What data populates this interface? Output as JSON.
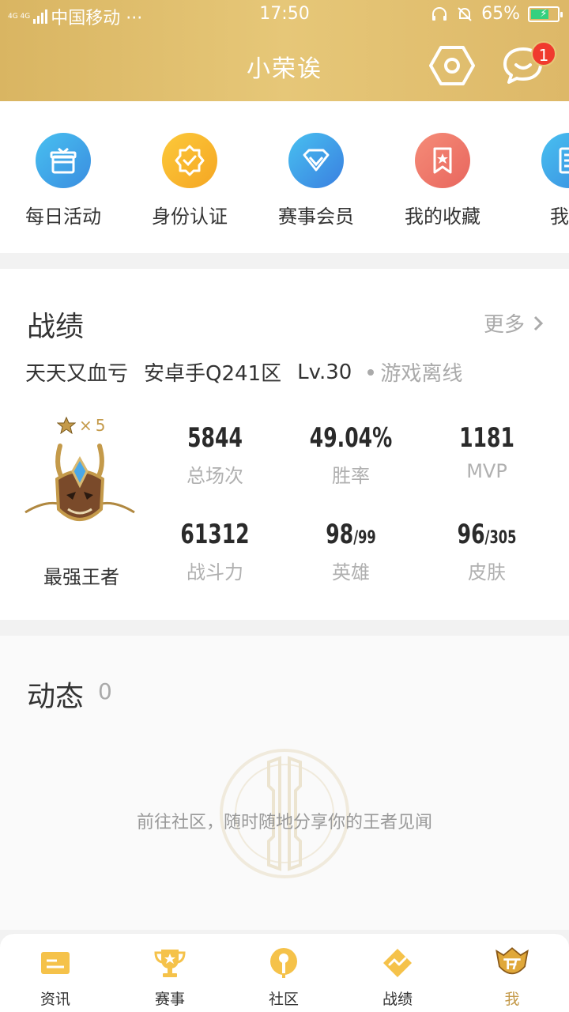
{
  "status_bar": {
    "network": "4G 4G",
    "carrier": "中国移动 ···",
    "time": "17:50",
    "battery": "65%"
  },
  "header": {
    "title": "小荣诶",
    "message_badge": "1"
  },
  "quick_actions": [
    {
      "label": "每日活动",
      "icon": "gift-icon",
      "color": "#3ba6e8"
    },
    {
      "label": "身份认证",
      "icon": "verified-badge-icon",
      "color": "#f7b32b"
    },
    {
      "label": "赛事会员",
      "icon": "diamond-icon",
      "color": "#3ba6e8"
    },
    {
      "label": "我的收藏",
      "icon": "bookmark-icon",
      "color": "#ef7b6b"
    },
    {
      "label": "我的",
      "icon": "document-icon",
      "color": "#3ba6e8"
    }
  ],
  "stats": {
    "title": "战绩",
    "more": "更多",
    "player_name": "天天又血亏",
    "server": "安卓手Q241区",
    "level": "Lv.30",
    "online_status": "游戏离线",
    "stars_prefix": "×",
    "stars": "5",
    "rank": "最强王者",
    "items": [
      {
        "value": "5844",
        "sub": "",
        "label": "总场次"
      },
      {
        "value": "49.04%",
        "sub": "",
        "label": "胜率"
      },
      {
        "value": "1181",
        "sub": "",
        "label": "MVP"
      },
      {
        "value": "61312",
        "sub": "",
        "label": "战斗力"
      },
      {
        "value": "98",
        "sub": "/99",
        "label": "英雄"
      },
      {
        "value": "96",
        "sub": "/305",
        "label": "皮肤"
      }
    ]
  },
  "moments": {
    "title": "动态",
    "count": "0",
    "empty_text": "前往社区，随时随地分享你的王者见闻"
  },
  "nav": [
    {
      "label": "资讯",
      "icon": "news-icon"
    },
    {
      "label": "赛事",
      "icon": "trophy-icon"
    },
    {
      "label": "社区",
      "icon": "community-icon"
    },
    {
      "label": "战绩",
      "icon": "stats-icon"
    },
    {
      "label": "我",
      "icon": "profile-icon",
      "active": true
    }
  ],
  "colors": {
    "header_gold": "#e6c778",
    "accent_gold": "#c49a4a",
    "badge_red": "#f03a2e"
  }
}
